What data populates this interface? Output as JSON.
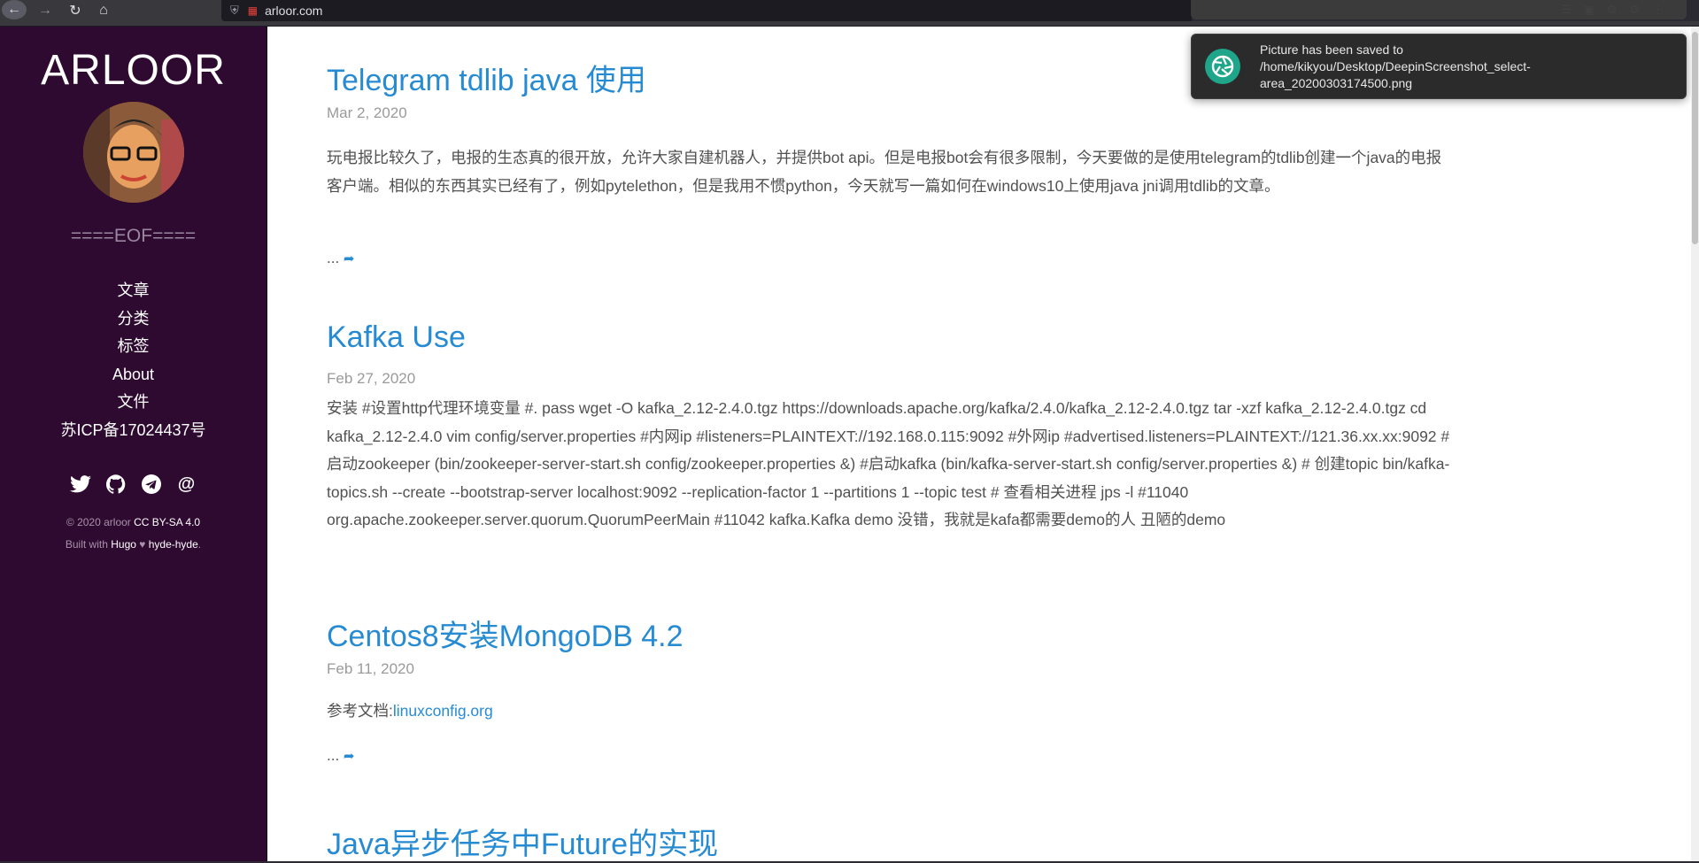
{
  "browser": {
    "url": "arloor.com",
    "back_icon": "arrow-left-icon",
    "forward_icon": "arrow-right-icon",
    "reload_icon": "reload-icon",
    "home_icon": "home-icon"
  },
  "sidebar": {
    "brand": "ARLOOR",
    "tagline": "====EOF====",
    "nav": [
      "文章",
      "分类",
      "标签",
      "About",
      "文件",
      "苏ICP备17024437号"
    ],
    "social": [
      "twitter-icon",
      "github-icon",
      "telegram-icon",
      "email-icon"
    ],
    "copyright_prefix": "© 2020 arloor",
    "license": "CC BY-SA 4.0",
    "built_prefix": "Built with",
    "hugo": "Hugo",
    "heart": "♥",
    "theme": "hyde-hyde",
    "period": ".",
    "bg_color": "#2e0a30"
  },
  "posts": [
    {
      "title": "Telegram tdlib java 使用",
      "date": "Mar 2, 2020",
      "body": "玩电报比较久了，电报的生态真的很开放，允许大家自建机器人，并提供bot api。但是电报bot会有很多限制，今天要做的是使用telegram的tdlib创建一个java的电报客户端。相似的东西其实已经有了，例如pytelethon，但是我用不惯python，今天就写一篇如何在windows10上使用java jni调用tdlib的文章。",
      "more": "..."
    },
    {
      "title": "Kafka Use",
      "date": "Feb 27, 2020",
      "body": "安装 #设置http代理环境变量 #. pass wget -O kafka_2.12-2.4.0.tgz https://downloads.apache.org/kafka/2.4.0/kafka_2.12-2.4.0.tgz tar -xzf kafka_2.12-2.4.0.tgz cd kafka_2.12-2.4.0 vim config/server.properties #内网ip #listeners=PLAINTEXT://192.168.0.115:9092 #外网ip #advertised.listeners=PLAINTEXT://121.36.xx.xx:9092 #启动zookeeper (bin/zookeeper-server-start.sh config/zookeeper.properties &) #启动kafka (bin/kafka-server-start.sh config/server.properties &) # 创建topic bin/kafka-topics.sh --create --bootstrap-server localhost:9092 --replication-factor 1 --partitions 1 --topic test # 查看相关进程 jps -l #11040 org.apache.zookeeper.server.quorum.QuorumPeerMain #11042 kafka.Kafka demo 没错，我就是kafa都需要demo的人 丑陋的demo"
    },
    {
      "title": "Centos8安装MongoDB 4.2",
      "date": "Feb 11, 2020",
      "body_prefix": "参考文档:",
      "body_link": "linuxconfig.org",
      "more": "..."
    },
    {
      "title": "Java异步任务中Future的实现"
    }
  ],
  "notification": {
    "icon": "camera-shutter-icon",
    "text": "Picture has been saved to /home/kikyou/Desktop/DeepinScreenshot_select-area_20200303174500.png"
  },
  "colors": {
    "link": "#268bd2",
    "text": "#515151",
    "date": "#9a9a9a"
  }
}
